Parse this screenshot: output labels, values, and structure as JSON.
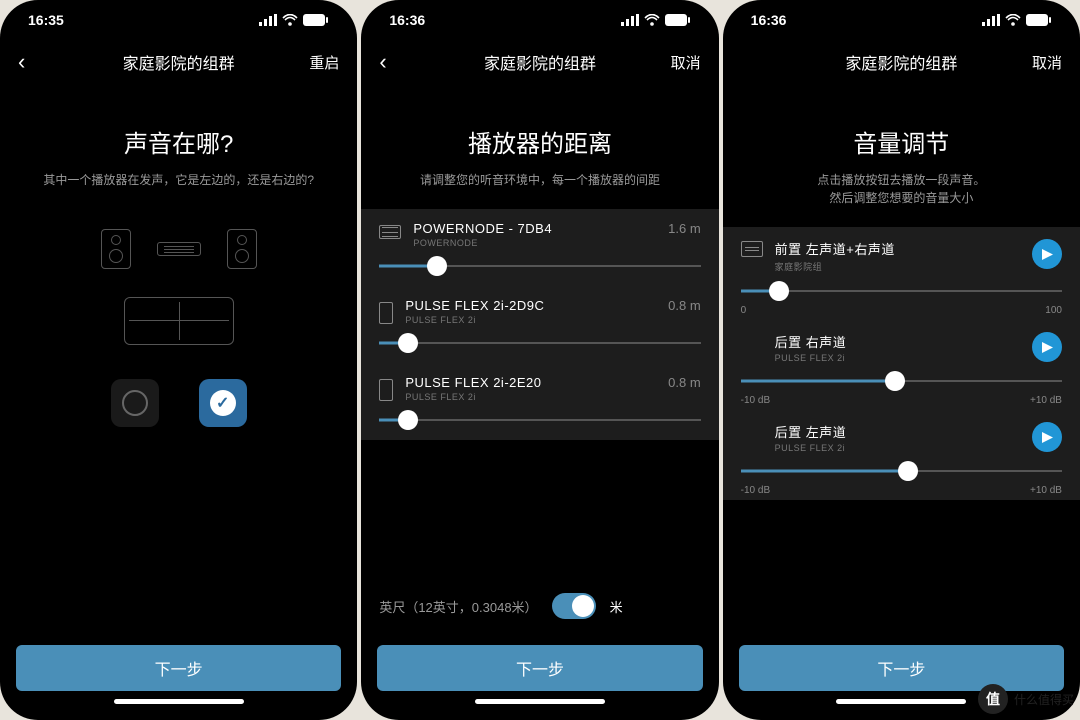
{
  "screens": [
    {
      "time": "16:35",
      "nav": {
        "title": "家庭影院的组群",
        "right": "重启"
      },
      "page": {
        "title": "声音在哪?",
        "subtitle": "其中一个播放器在发声，它是左边的，还是右边的?",
        "next_label": "下一步"
      }
    },
    {
      "time": "16:36",
      "nav": {
        "title": "家庭影院的组群",
        "right": "取消"
      },
      "page": {
        "title": "播放器的距离",
        "subtitle": "请调整您的听音环境中，每一个播放器的间距",
        "items": [
          {
            "name": "POWERNODE - 7DB4",
            "sub": "POWERNODE",
            "value": "1.6 m",
            "pct": 18
          },
          {
            "name": "PULSE FLEX 2i-2D9C",
            "sub": "PULSE FLEX 2i",
            "value": "0.8 m",
            "pct": 9
          },
          {
            "name": "PULSE FLEX 2i-2E20",
            "sub": "PULSE FLEX 2i",
            "value": "0.8 m",
            "pct": 9
          }
        ],
        "unit_label": "英尺（12英寸，0.3048米）",
        "unit_right": "米",
        "next_label": "下一步"
      }
    },
    {
      "time": "16:36",
      "nav": {
        "title": "家庭影院的组群",
        "right": "取消"
      },
      "page": {
        "title": "音量调节",
        "subtitle": "点击播放按钮去播放一段声音。\n然后调整您想要的音量大小",
        "items": [
          {
            "name": "前置 左声道+右声道",
            "sub": "家庭影院组",
            "min": "0",
            "max": "100",
            "pct": 12
          },
          {
            "name": "后置 右声道",
            "sub": "PULSE FLEX 2i",
            "min": "-10 dB",
            "max": "+10 dB",
            "pct": 48
          },
          {
            "name": "后置 左声道",
            "sub": "PULSE FLEX 2i",
            "min": "-10 dB",
            "max": "+10 dB",
            "pct": 52
          }
        ],
        "next_label": "下一步"
      }
    }
  ],
  "watermark": "什么值得买"
}
